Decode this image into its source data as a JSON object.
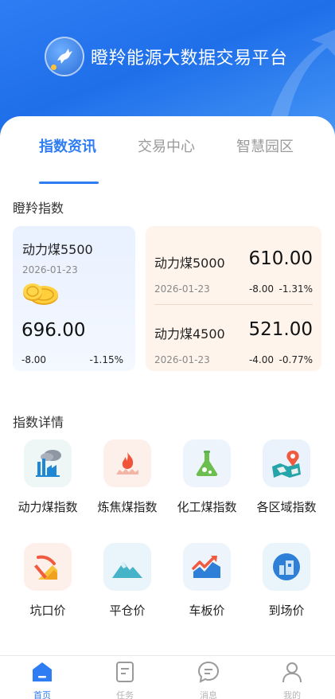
{
  "header": {
    "title": "瞪羚能源大数据交易平台",
    "logo_icon": "gazelle-logo-icon"
  },
  "tabs": [
    {
      "label": "指数资讯",
      "active": true
    },
    {
      "label": "交易中心",
      "active": false
    },
    {
      "label": "智慧园区",
      "active": false
    }
  ],
  "index_section": {
    "title": "瞪羚指数",
    "featured": {
      "name": "动力煤5500",
      "date": "2026-01-23",
      "price": "696.00",
      "change": "-8.00",
      "percent": "-1.15%",
      "icon": "gold-coins-icon"
    },
    "others": [
      {
        "name": "动力煤5000",
        "price": "610.00",
        "date": "2026-01-23",
        "change": "-8.00",
        "percent": "-1.31%"
      },
      {
        "name": "动力煤4500",
        "price": "521.00",
        "date": "2026-01-23",
        "change": "-4.00",
        "percent": "-0.77%"
      }
    ]
  },
  "detail_section": {
    "title": "指数详情",
    "items": [
      {
        "label": "动力煤指数",
        "icon": "factory-icon"
      },
      {
        "label": "炼焦煤指数",
        "icon": "flame-icon"
      },
      {
        "label": "化工煤指数",
        "icon": "flask-icon"
      },
      {
        "label": "各区域指数",
        "icon": "map-pin-icon"
      },
      {
        "label": "坑口价",
        "icon": "mine-pickaxe-icon"
      },
      {
        "label": "平仓价",
        "icon": "mountain-icon"
      },
      {
        "label": "车板价",
        "icon": "trend-chart-icon"
      },
      {
        "label": "到场价",
        "icon": "warehouse-icon"
      }
    ]
  },
  "bottom_nav": [
    {
      "label": "首页",
      "icon": "home-icon",
      "active": true
    },
    {
      "label": "任务",
      "icon": "task-icon",
      "active": false
    },
    {
      "label": "消息",
      "icon": "message-icon",
      "active": false
    },
    {
      "label": "我的",
      "icon": "user-icon",
      "active": false
    }
  ],
  "colors": {
    "primary": "#2f7df3",
    "card_blue": "#e9f1ff",
    "card_orange": "#fff4ec"
  }
}
